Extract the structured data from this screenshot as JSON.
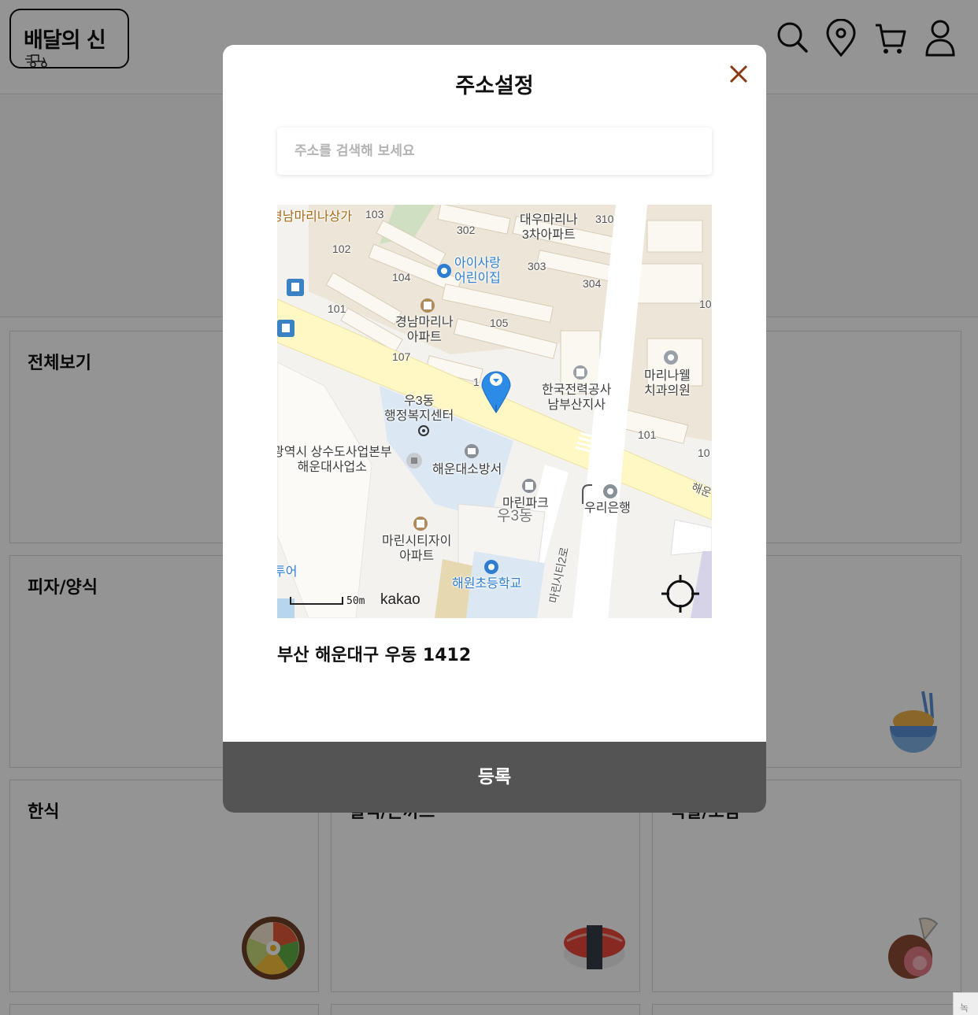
{
  "app": {
    "logo_text": "배달의 신"
  },
  "categories": [
    {
      "label": "전체보기",
      "food": "chicken-leg"
    },
    {
      "label": "",
      "food": ""
    },
    {
      "label": "",
      "food": ""
    },
    {
      "label": "피자/양식",
      "food": "noodle-bowl"
    },
    {
      "label": "",
      "food": ""
    },
    {
      "label": "",
      "food": ""
    },
    {
      "label": "한식",
      "food": "bibimbap"
    },
    {
      "label": "일식/돈까스",
      "food": "sushi"
    },
    {
      "label": "족발/보쌈",
      "food": "meat"
    }
  ],
  "modal": {
    "title": "주소설정",
    "search_placeholder": "주소를 검색해 보세요",
    "address": "부산 해운대구 우동 1412",
    "register_label": "등록"
  },
  "map": {
    "scale_label": "50m",
    "provider": "kakao",
    "labels": {
      "apt_mall": "경남마리나상가",
      "b103a": "103",
      "b302": "302",
      "daewoo": "대우마리나\n3차아파트",
      "b310": "310",
      "b102a": "102",
      "children": "아이사랑\n어린이집",
      "b303": "303",
      "b104": "104",
      "b304": "304",
      "b10x": "10",
      "b101a": "101",
      "gyeongnam": "경남마리나\n아파트",
      "b105": "105",
      "b107": "107",
      "b1x": "1",
      "kepco": "한국전력공사\n남부산지사",
      "dental": "마리나웰\n치과의원",
      "woo3": "우3동\n행정복지센터",
      "b101b": "101",
      "b10y": "10",
      "water": "광역시 상수도사업본부\n해운대사업소",
      "fire": "해운대소방서",
      "haeun": "해운",
      "marinpark": "마린파크",
      "woo3dong": "우3동",
      "woori": "우리은행",
      "marincity": "마린시티자이\n아파트",
      "tour": "투어",
      "school": "해원초등학교",
      "road2": "마린시티2로"
    }
  },
  "colors": {
    "overlay": "rgba(0,0,0,0.42)",
    "close_icon": "#8a3a12",
    "register_bg": "#545454",
    "pin": "#2b8be6",
    "road_main": "#fff8c4",
    "block": "#ede6d8"
  }
}
